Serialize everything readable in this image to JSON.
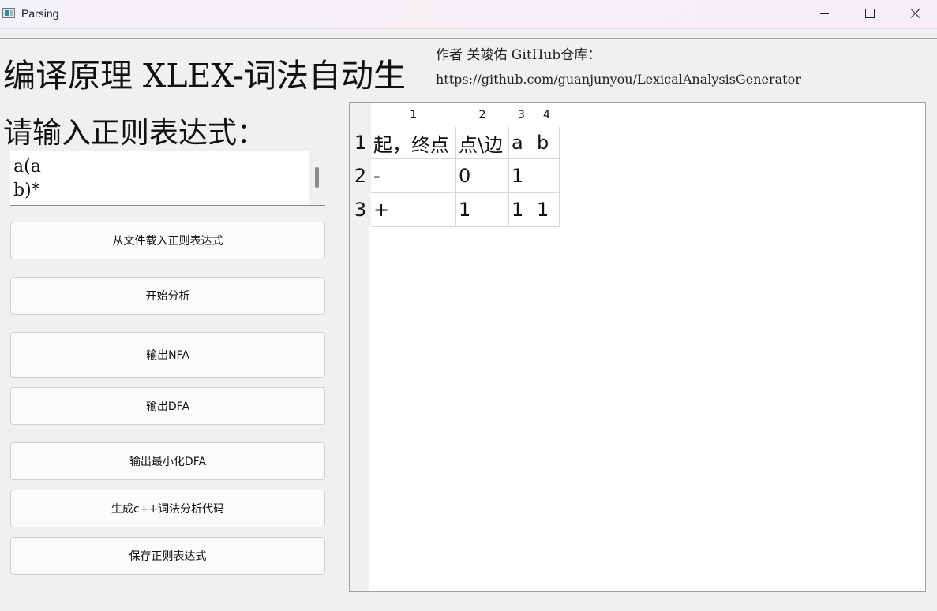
{
  "window": {
    "title": "Parsing"
  },
  "header": {
    "title": "编译原理 XLEX-词法自动生",
    "author_line": "作者 关竣佑 GitHub仓库：",
    "github_url": "https://github.com/guanjunyou/LexicalAnalysisGenerator"
  },
  "input": {
    "prompt": "请输入正则表达式：",
    "regex_value": "a(a\nb)*"
  },
  "buttons": {
    "load_file": "从文件载入正则表达式",
    "start_analysis": "开始分析",
    "output_nfa": "输出NFA",
    "output_dfa": "输出DFA",
    "output_min_dfa": "输出最小化DFA",
    "generate_cpp": "生成c++词法分析代码",
    "save_regex": "保存正则表达式"
  },
  "table": {
    "column_headers": [
      "1",
      "2",
      "3",
      "4"
    ],
    "row_headers": [
      "1",
      "2",
      "3"
    ],
    "rows": [
      [
        "起，终点",
        "点\\边",
        "a",
        "b"
      ],
      [
        "-",
        "0",
        "1",
        ""
      ],
      [
        "+",
        "1",
        "1",
        "1"
      ]
    ]
  },
  "icons": {
    "app": "app-window-icon",
    "minimize": "minimize-icon",
    "maximize": "maximize-icon",
    "close": "close-icon"
  }
}
